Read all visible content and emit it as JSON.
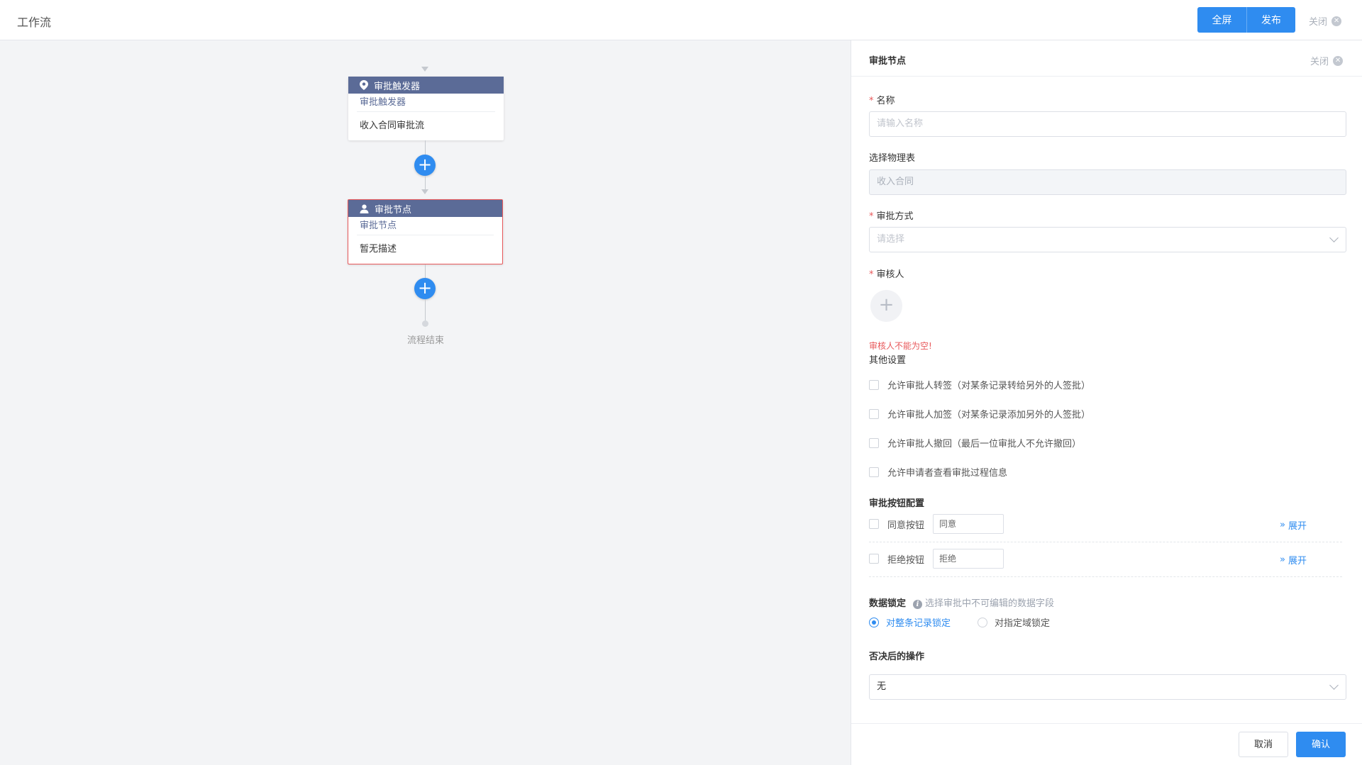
{
  "header": {
    "title": "工作流",
    "fullscreen_label": "全屏",
    "publish_label": "发布",
    "close_label": "关闭"
  },
  "canvas": {
    "trigger_node": {
      "title": "审批触发器",
      "subtitle": "审批触发器",
      "description": "收入合同审批流"
    },
    "approval_node": {
      "title": "审批节点",
      "subtitle": "审批节点",
      "description": "暂无描述"
    },
    "end_label": "流程结束",
    "add_symbol": "+"
  },
  "panel": {
    "title": "审批节点",
    "close_label": "关闭",
    "name": {
      "label": "名称",
      "placeholder": "请输入名称"
    },
    "table": {
      "label": "选择物理表",
      "value": "收入合同"
    },
    "method": {
      "label": "审批方式",
      "placeholder": "请选择"
    },
    "reviewer": {
      "label": "审核人",
      "error": "审核人不能为空!"
    },
    "other": {
      "title": "其他设置",
      "options": [
        "允许审批人转签（对某条记录转给另外的人签批）",
        "允许审批人加签（对某条记录添加另外的人签批）",
        "允许审批人撤回（最后一位审批人不允许撤回）",
        "允许申请者查看审批过程信息"
      ]
    },
    "buttons_config": {
      "title": "审批按钮配置",
      "agree": {
        "label": "同意按钮",
        "value": "同意",
        "expand": "展开"
      },
      "reject": {
        "label": "拒绝按钮",
        "value": "拒绝",
        "expand": "展开"
      }
    },
    "data_lock": {
      "title": "数据锁定",
      "hint": "选择审批中不可编辑的数据字段",
      "option_record": "对整条记录锁定",
      "option_field": "对指定域锁定"
    },
    "after_reject": {
      "title": "否决后的操作",
      "value": "无"
    },
    "cancel_label": "取消",
    "confirm_label": "确认"
  },
  "colors": {
    "accent": "#2f8cf0",
    "node_header": "#5b6b97",
    "error": "#e8585a"
  }
}
